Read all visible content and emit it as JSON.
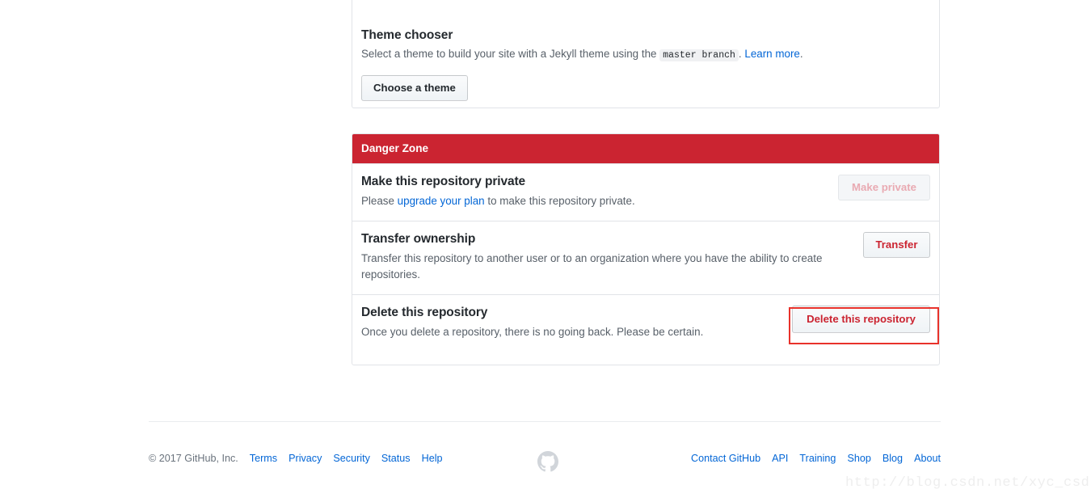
{
  "theme_chooser": {
    "title": "Theme chooser",
    "description_before": "Select a theme to build your site with a Jekyll theme using the ",
    "branch_code": "master branch",
    "description_after": ".",
    "learn_more_label": "Learn more",
    "learn_more_suffix": ".",
    "button_label": "Choose a theme"
  },
  "danger_zone": {
    "header": "Danger Zone",
    "header_color": "#cb2431",
    "rows": [
      {
        "title": "Make this repository private",
        "desc_before": "Please ",
        "link_label": "upgrade your plan",
        "desc_after": " to make this repository private.",
        "button_label": "Make private",
        "button_state": "disabled"
      },
      {
        "title": "Transfer ownership",
        "desc": "Transfer this repository to another user or to an organization where you have the ability to create repositories.",
        "button_label": "Transfer",
        "button_state": "danger"
      },
      {
        "title": "Delete this repository",
        "desc": "Once you delete a repository, there is no going back. Please be certain.",
        "button_label": "Delete this repository",
        "button_state": "danger",
        "highlighted": true,
        "highlight_color": "#e8322b"
      }
    ]
  },
  "footer": {
    "copyright": "© 2017 GitHub, Inc.",
    "left_links": [
      "Terms",
      "Privacy",
      "Security",
      "Status",
      "Help"
    ],
    "right_links": [
      "Contact GitHub",
      "API",
      "Training",
      "Shop",
      "Blog",
      "About"
    ],
    "mark_icon": "github-octocat-icon"
  },
  "watermark": {
    "text": "http://blog.csdn.net/xyc_csdn"
  }
}
